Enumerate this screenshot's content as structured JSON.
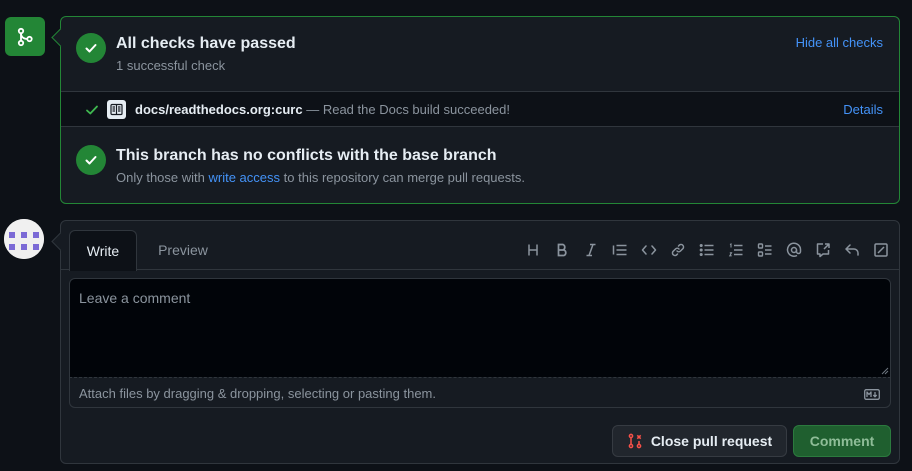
{
  "merge_status": {
    "checks_title": "All checks have passed",
    "checks_subtitle": "1 successful check",
    "hide_checks_label": "Hide all checks",
    "check_item": {
      "name": "docs/readthedocs.org:curc",
      "description": " — Read the Docs build succeeded!",
      "details_label": "Details"
    },
    "conflicts_title": "This branch has no conflicts with the base branch",
    "conflicts_text_before": "Only those with ",
    "conflicts_link": "write access",
    "conflicts_text_after": " to this repository can merge pull requests."
  },
  "comment": {
    "tabs": [
      {
        "label": "Write",
        "active": true
      },
      {
        "label": "Preview",
        "active": false
      }
    ],
    "toolbar_icons": [
      "heading-icon",
      "bold-icon",
      "italic-icon",
      "quote-icon",
      "code-icon",
      "link-icon",
      "unordered-list-icon",
      "ordered-list-icon",
      "task-list-icon",
      "mention-icon",
      "cross-reference-icon",
      "reply-icon",
      "fullscreen-icon"
    ],
    "placeholder": "Leave a comment",
    "value": "",
    "attach_text": "Attach files by dragging & dropping, selecting or pasting them.",
    "close_button_label": "Close pull request",
    "comment_button_label": "Comment"
  },
  "colors": {
    "success": "#238636",
    "link": "#4493f8",
    "danger": "#f85149",
    "background": "#0d1117",
    "surface": "#161b22"
  }
}
